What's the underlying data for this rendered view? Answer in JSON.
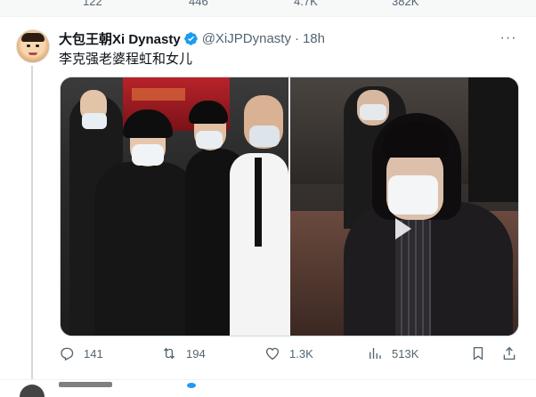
{
  "previous_tweet_metrics": {
    "replies": "122",
    "retweets": "446",
    "likes": "4.7K",
    "views": "382K"
  },
  "tweet": {
    "author_name": "大包王朝Xi Dynasty",
    "verified": true,
    "handle": "@XiJPDynasty",
    "separator": "·",
    "time": "18h",
    "more_label": "···",
    "text": "李克强老婆程虹和女儿",
    "media": {
      "left_photo_icon": "photo-left",
      "right_photo_icon": "photo-right"
    },
    "metrics": {
      "replies": "141",
      "retweets": "194",
      "likes": "1.3K",
      "views": "513K"
    }
  },
  "colors": {
    "accent": "#1d9bf0",
    "muted": "#536471",
    "text": "#0f1419",
    "line": "#cfd9de"
  }
}
